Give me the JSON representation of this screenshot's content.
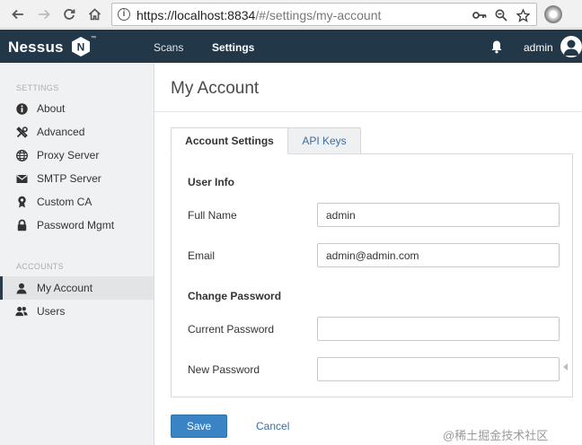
{
  "browser": {
    "url_host": "https://localhost:8834",
    "url_path": "/#/settings/my-account"
  },
  "app": {
    "logo_text": "Nessus",
    "logo_mark": "N",
    "trademark": "™",
    "nav": [
      {
        "label": "Scans",
        "active": false
      },
      {
        "label": "Settings",
        "active": true
      }
    ],
    "username": "admin"
  },
  "sidebar": {
    "settings_heading": "SETTINGS",
    "settings_items": [
      {
        "label": "About",
        "icon": "info-icon"
      },
      {
        "label": "Advanced",
        "icon": "tools-icon"
      },
      {
        "label": "Proxy Server",
        "icon": "globe-icon"
      },
      {
        "label": "SMTP Server",
        "icon": "envelope-icon"
      },
      {
        "label": "Custom CA",
        "icon": "certificate-icon"
      },
      {
        "label": "Password Mgmt",
        "icon": "lock-icon"
      }
    ],
    "accounts_heading": "ACCOUNTS",
    "accounts_items": [
      {
        "label": "My Account",
        "icon": "user-icon",
        "selected": true
      },
      {
        "label": "Users",
        "icon": "users-icon",
        "selected": false
      }
    ]
  },
  "main": {
    "title": "My Account",
    "tabs": [
      {
        "label": "Account Settings",
        "active": true
      },
      {
        "label": "API Keys",
        "active": false
      }
    ],
    "user_info_heading": "User Info",
    "full_name_label": "Full Name",
    "full_name_value": "admin",
    "email_label": "Email",
    "email_value": "admin@admin.com",
    "change_password_heading": "Change Password",
    "current_password_label": "Current Password",
    "current_password_value": "",
    "new_password_label": "New Password",
    "new_password_value": "",
    "save_label": "Save",
    "cancel_label": "Cancel"
  },
  "watermark": "@稀土掘金技术社区",
  "colors": {
    "topbar": "#223748",
    "primary_button": "#3a84c5",
    "link": "#3a6ea5",
    "sidebar_bg": "#f0f1f2"
  }
}
